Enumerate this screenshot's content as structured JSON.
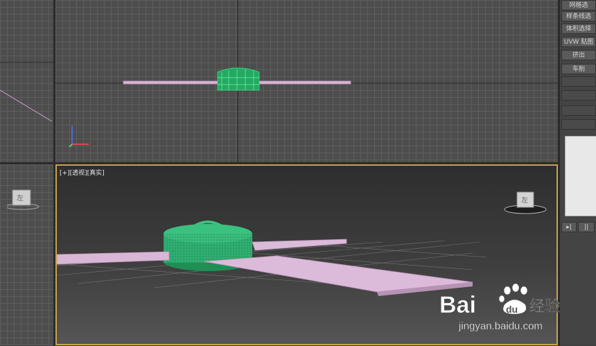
{
  "right_panel": {
    "buttons": [
      "网格选",
      "样条线选",
      "体积选择",
      "UVW 贴图",
      "挤出",
      "车削"
    ],
    "bottom_tools": [
      "▸|",
      "||"
    ]
  },
  "viewports": {
    "perspective_label": "[+][透视][真实]",
    "cube_top_text": "左",
    "cube_persp_text": "左"
  },
  "watermark": {
    "brand": "Bai",
    "brand2": "du",
    "product": "经验",
    "url": "jingyan.baidu.com"
  },
  "colors": {
    "viewport_border_active": "#c9a44a",
    "object_green": "#2ea86a",
    "plane_pink": "#d6b3d4"
  }
}
